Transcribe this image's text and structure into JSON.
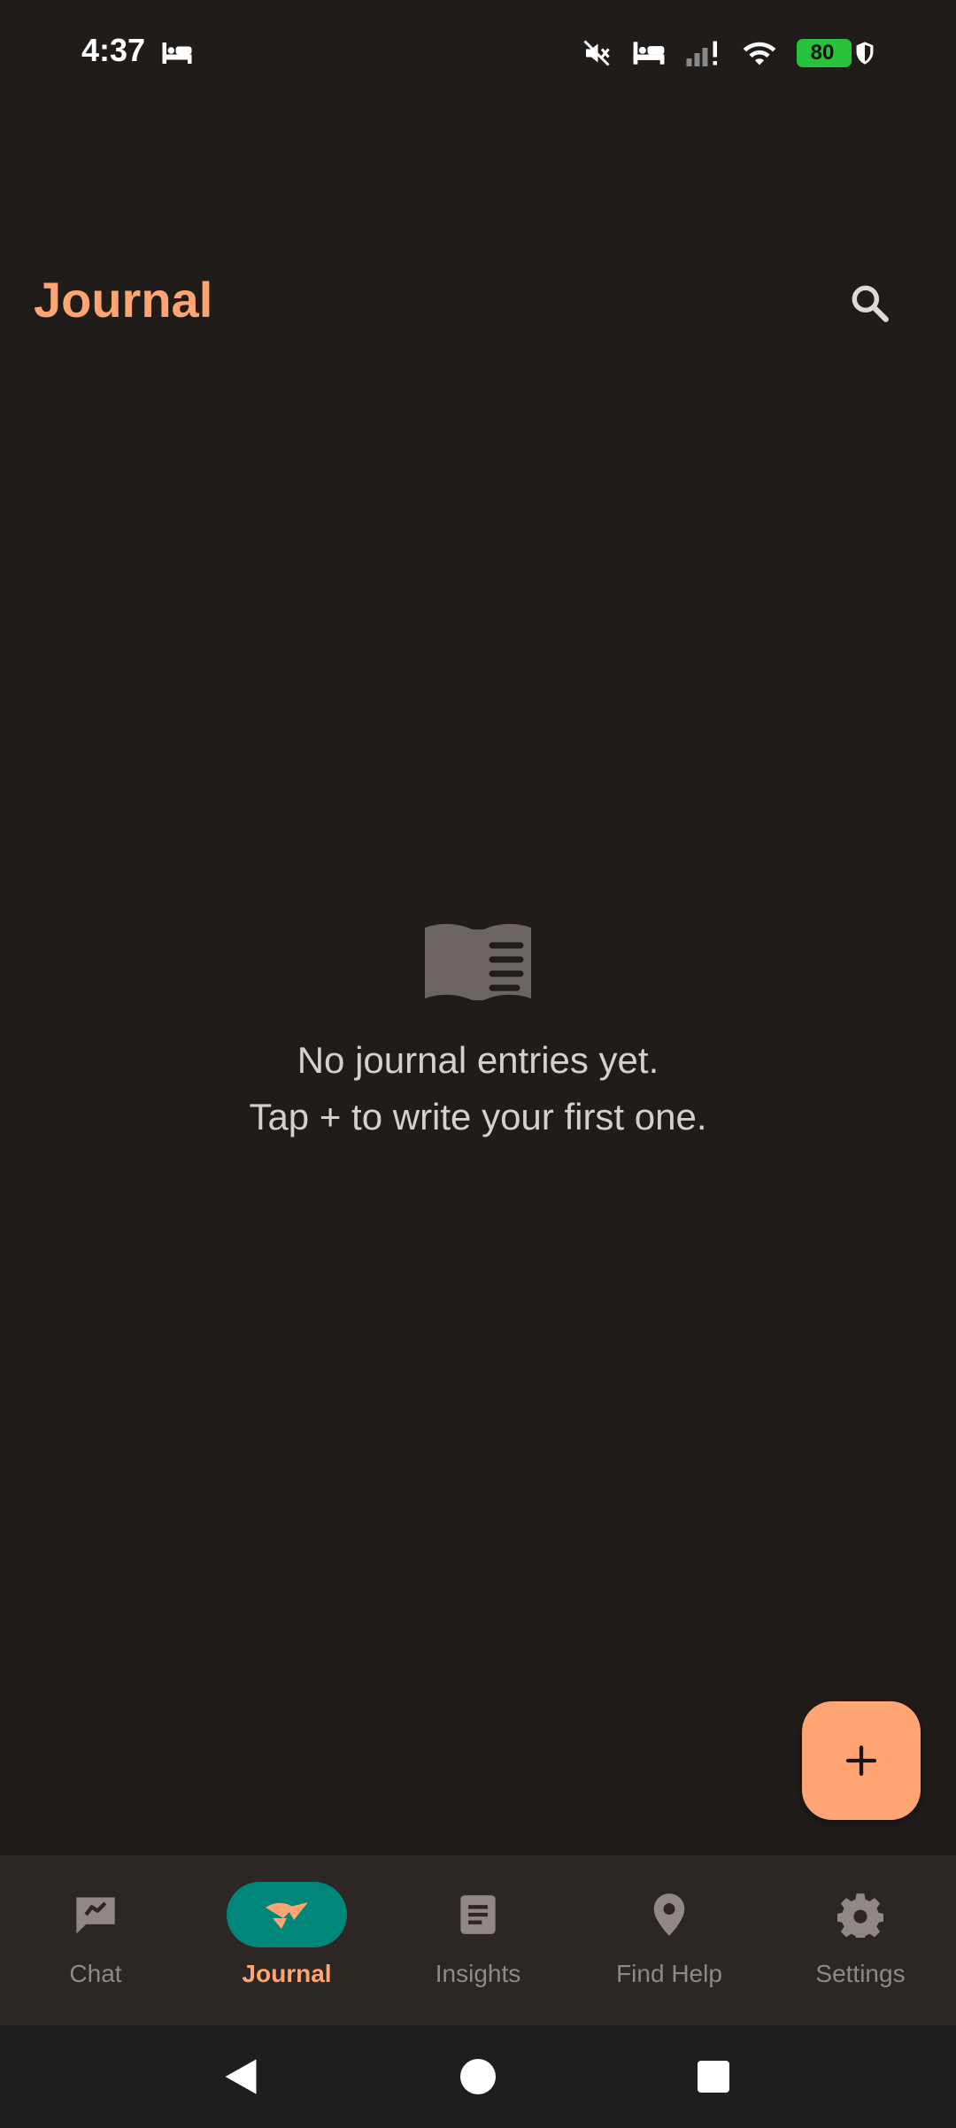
{
  "status": {
    "time": "4:37",
    "battery": "80"
  },
  "header": {
    "title": "Journal"
  },
  "empty_state": {
    "line1": "No journal entries yet.",
    "line2": "Tap + to write your first one."
  },
  "fab": {
    "icon": "plus-icon"
  },
  "nav": {
    "items": [
      {
        "label": "Chat",
        "icon": "chat-icon",
        "active": false
      },
      {
        "label": "Journal",
        "icon": "journal-icon",
        "active": true
      },
      {
        "label": "Insights",
        "icon": "insights-icon",
        "active": false
      },
      {
        "label": "Find Help",
        "icon": "location-pin-icon",
        "active": false
      },
      {
        "label": "Settings",
        "icon": "gear-icon",
        "active": false
      }
    ]
  },
  "colors": {
    "background": "#201c1a",
    "accent": "#ffa574",
    "active_pill": "#00877a",
    "nav_background": "#2c2725"
  }
}
